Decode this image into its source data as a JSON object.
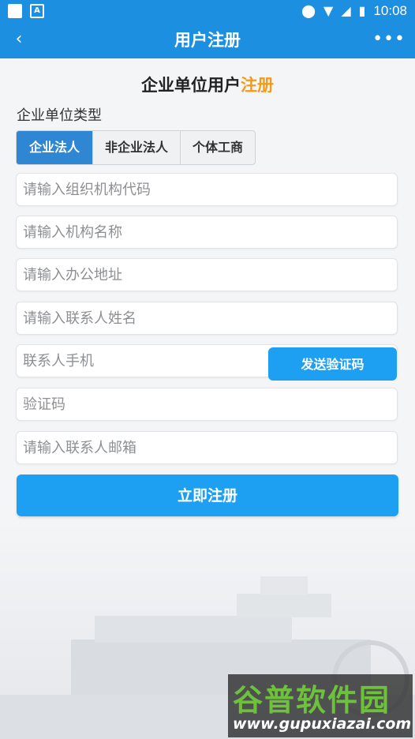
{
  "statusbar": {
    "time": "10:08",
    "icons": [
      "app-square-icon",
      "a-notification-icon",
      "location-icon",
      "wifi-icon",
      "signal-icon",
      "battery-icon"
    ]
  },
  "header": {
    "back_icon": "‹",
    "title": "用户注册",
    "more_icon": "•••"
  },
  "heading": {
    "main": "企业单位用户",
    "accent": "注册"
  },
  "type_section": {
    "label": "企业单位类型",
    "options": [
      "企业法人",
      "非企业法人",
      "个体工商"
    ],
    "selected": "企业法人"
  },
  "form": {
    "org_code_placeholder": "请输入组织机构代码",
    "org_name_placeholder": "请输入机构名称",
    "address_placeholder": "请输入办公地址",
    "contact_name_placeholder": "请输入联系人姓名",
    "contact_phone_placeholder": "联系人手机",
    "send_code_label": "发送验证码",
    "verify_code_placeholder": "验证码",
    "email_placeholder": "请输入联系人邮箱",
    "submit_label": "立即注册"
  },
  "watermark": {
    "title": "谷普软件园",
    "url": "www.gupuxiazai.com"
  },
  "colors": {
    "primary": "#1c8fe0",
    "button": "#1ea0f2",
    "accent": "#f59a14",
    "selected_segment": "#2f86d3"
  }
}
